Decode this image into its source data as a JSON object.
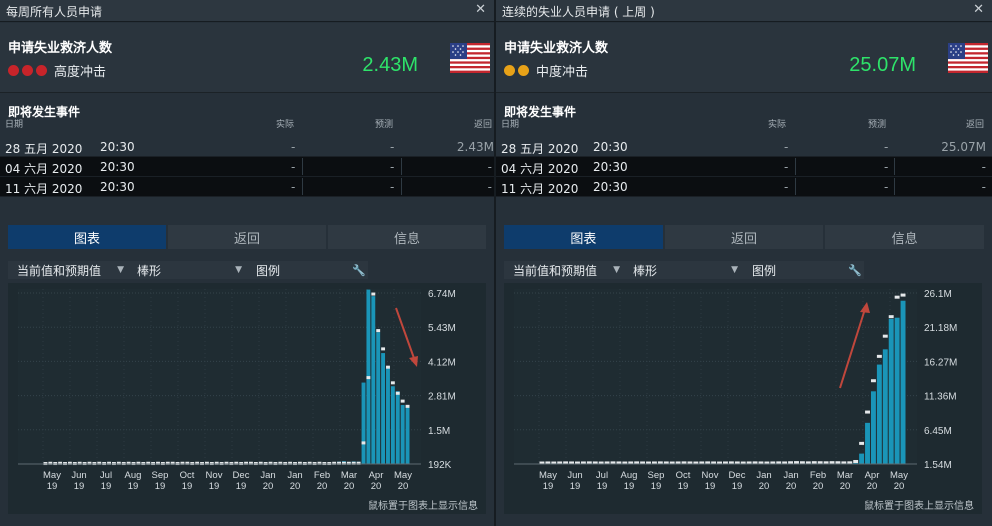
{
  "panels": [
    {
      "title": "每周所有人员申请",
      "indicator": "申请失业救济人数",
      "impact_label": "高度冲击",
      "impact_dots": [
        "#c8242a",
        "#c8242a",
        "#c8242a"
      ],
      "current_value": "2.43M",
      "events_header": "即将发生事件",
      "columns": {
        "date": "日期",
        "actual": "实际",
        "forecast": "预测",
        "previous": "返回"
      },
      "events": [
        {
          "date": "28 五月 2020",
          "time": "20:30",
          "actual": "-",
          "forecast": "-",
          "previous": "2.43M"
        },
        {
          "date": "04 六月 2020",
          "time": "20:30",
          "actual": "-",
          "forecast": "-",
          "previous": "-"
        },
        {
          "date": "11 六月 2020",
          "time": "20:30",
          "actual": "-",
          "forecast": "-",
          "previous": "-"
        }
      ],
      "tabs": [
        "图表",
        "返回",
        "信息"
      ],
      "toolbar": {
        "values": "当前值和预期值",
        "chart_type": "棒形",
        "legend": "图例"
      },
      "hint": "鼠标置于图表上显示信息",
      "colors": {
        "bar": "#1a95b8",
        "arrow": "#c0473c",
        "marker": "#e6e9eb"
      },
      "arrow_direction": "down",
      "chart_data": {
        "type": "bar",
        "y_tick_labels": [
          "6.74M",
          "5.43M",
          "4.12M",
          "2.81M",
          "1.5M",
          "192K"
        ],
        "ylim_millions": [
          0.192,
          6.74
        ],
        "x_tick_labels": [
          [
            "May",
            "19"
          ],
          [
            "Jun",
            "19"
          ],
          [
            "Jul",
            "19"
          ],
          [
            "Aug",
            "19"
          ],
          [
            "Sep",
            "19"
          ],
          [
            "Oct",
            "19"
          ],
          [
            "Nov",
            "19"
          ],
          [
            "Dec",
            "19"
          ],
          [
            "Jan",
            "20"
          ],
          [
            "Jan",
            "20"
          ],
          [
            "Feb",
            "20"
          ],
          [
            "Mar",
            "20"
          ],
          [
            "Apr",
            "20"
          ],
          [
            "May",
            "20"
          ]
        ],
        "values_millions": [
          0.21,
          0.22,
          0.21,
          0.22,
          0.21,
          0.22,
          0.21,
          0.22,
          0.21,
          0.22,
          0.21,
          0.22,
          0.21,
          0.22,
          0.21,
          0.22,
          0.21,
          0.22,
          0.21,
          0.22,
          0.21,
          0.22,
          0.21,
          0.22,
          0.21,
          0.22,
          0.22,
          0.21,
          0.22,
          0.23,
          0.21,
          0.22,
          0.21,
          0.22,
          0.21,
          0.22,
          0.21,
          0.22,
          0.21,
          0.22,
          0.21,
          0.22,
          0.23,
          0.21,
          0.22,
          0.21,
          0.22,
          0.21,
          0.22,
          0.21,
          0.22,
          0.21,
          0.22,
          0.21,
          0.22,
          0.21,
          0.22,
          0.21,
          0.21,
          0.22,
          0.28,
          0.3,
          0.27,
          0.29,
          0.28,
          3.31,
          6.87,
          6.62,
          5.24,
          4.44,
          3.85,
          3.17,
          2.98,
          2.45,
          2.44
        ],
        "forecast_millions": [
          0.21,
          0.22,
          0.21,
          0.22,
          0.21,
          0.22,
          0.21,
          0.22,
          0.21,
          0.22,
          0.21,
          0.22,
          0.21,
          0.22,
          0.21,
          0.22,
          0.21,
          0.22,
          0.21,
          0.22,
          0.21,
          0.22,
          0.21,
          0.22,
          0.21,
          0.22,
          0.22,
          0.21,
          0.22,
          0.22,
          0.21,
          0.22,
          0.21,
          0.22,
          0.21,
          0.22,
          0.21,
          0.22,
          0.21,
          0.22,
          0.21,
          0.22,
          0.22,
          0.21,
          0.22,
          0.21,
          0.22,
          0.21,
          0.22,
          0.21,
          0.22,
          0.21,
          0.22,
          0.21,
          0.22,
          0.21,
          0.22,
          0.21,
          0.21,
          0.22,
          0.22,
          0.22,
          0.22,
          0.22,
          0.22,
          1.0,
          3.5,
          6.7,
          5.3,
          4.6,
          3.9,
          3.3,
          2.9,
          2.6,
          2.4
        ]
      }
    },
    {
      "title": "连续的失业人员申请 ( 上周 )",
      "indicator": "申请失业救济人数",
      "impact_label": "中度冲击",
      "impact_dots": [
        "#e8a218",
        "#e8a218"
      ],
      "current_value": "25.07M",
      "events_header": "即将发生事件",
      "columns": {
        "date": "日期",
        "actual": "实际",
        "forecast": "预测",
        "previous": "返回"
      },
      "events": [
        {
          "date": "28 五月 2020",
          "time": "20:30",
          "actual": "-",
          "forecast": "-",
          "previous": "25.07M"
        },
        {
          "date": "04 六月 2020",
          "time": "20:30",
          "actual": "-",
          "forecast": "-",
          "previous": "-"
        },
        {
          "date": "11 六月 2020",
          "time": "20:30",
          "actual": "-",
          "forecast": "-",
          "previous": "-"
        }
      ],
      "tabs": [
        "图表",
        "返回",
        "信息"
      ],
      "toolbar": {
        "values": "当前值和预期值",
        "chart_type": "棒形",
        "legend": "图例"
      },
      "hint": "鼠标置于图表上显示信息",
      "colors": {
        "bar": "#1a95b8",
        "arrow": "#c0473c",
        "marker": "#e6e9eb"
      },
      "arrow_direction": "up",
      "chart_data": {
        "type": "bar",
        "y_tick_labels": [
          "26.1M",
          "21.18M",
          "16.27M",
          "11.36M",
          "6.45M",
          "1.54M"
        ],
        "ylim_millions": [
          1.54,
          26.1
        ],
        "x_tick_labels": [
          [
            "May",
            "19"
          ],
          [
            "Jun",
            "19"
          ],
          [
            "Jul",
            "19"
          ],
          [
            "Aug",
            "19"
          ],
          [
            "Sep",
            "19"
          ],
          [
            "Oct",
            "19"
          ],
          [
            "Nov",
            "19"
          ],
          [
            "Dec",
            "19"
          ],
          [
            "Jan",
            "20"
          ],
          [
            "Jan",
            "20"
          ],
          [
            "Feb",
            "20"
          ],
          [
            "Mar",
            "20"
          ],
          [
            "Apr",
            "20"
          ],
          [
            "May",
            "20"
          ]
        ],
        "values_millions": [
          1.68,
          1.69,
          1.68,
          1.69,
          1.7,
          1.69,
          1.68,
          1.69,
          1.7,
          1.69,
          1.68,
          1.69,
          1.7,
          1.69,
          1.68,
          1.69,
          1.7,
          1.69,
          1.68,
          1.69,
          1.7,
          1.69,
          1.68,
          1.69,
          1.7,
          1.69,
          1.68,
          1.69,
          1.7,
          1.69,
          1.68,
          1.69,
          1.7,
          1.69,
          1.68,
          1.69,
          1.7,
          1.69,
          1.68,
          1.69,
          1.7,
          1.69,
          1.72,
          1.75,
          1.72,
          1.7,
          1.73,
          1.72,
          1.71,
          1.73,
          1.72,
          1.7,
          1.71,
          1.73,
          3.03,
          7.45,
          11.98,
          15.82,
          18.01,
          22.38,
          22.55,
          24.99
        ],
        "forecast_millions": [
          1.68,
          1.69,
          1.68,
          1.69,
          1.7,
          1.69,
          1.68,
          1.69,
          1.7,
          1.69,
          1.68,
          1.69,
          1.7,
          1.69,
          1.68,
          1.69,
          1.7,
          1.69,
          1.68,
          1.69,
          1.7,
          1.69,
          1.68,
          1.69,
          1.7,
          1.69,
          1.68,
          1.69,
          1.7,
          1.69,
          1.68,
          1.69,
          1.7,
          1.69,
          1.68,
          1.69,
          1.7,
          1.69,
          1.68,
          1.69,
          1.7,
          1.69,
          1.72,
          1.74,
          1.72,
          1.7,
          1.73,
          1.72,
          1.71,
          1.73,
          1.72,
          1.7,
          1.71,
          1.9,
          4.5,
          9.0,
          13.5,
          17.0,
          19.9,
          22.7,
          25.5,
          25.8
        ]
      }
    }
  ]
}
